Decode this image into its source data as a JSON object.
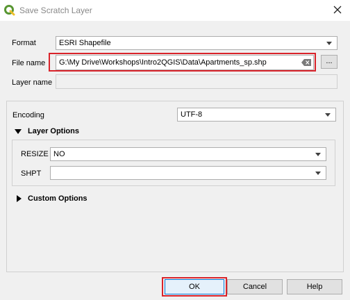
{
  "window": {
    "title": "Save Scratch Layer"
  },
  "form": {
    "format_label": "Format",
    "format_value": "ESRI Shapefile",
    "filename_label": "File name",
    "filename_value": "G:\\My Drive\\Workshops\\Intro2QGIS\\Data\\Apartments_sp.shp",
    "browse_label": "...",
    "layername_label": "Layer name",
    "layername_value": ""
  },
  "encoding": {
    "label": "Encoding",
    "value": "UTF-8"
  },
  "layer_options": {
    "title": "Layer Options",
    "expanded": true,
    "resize_label": "RESIZE",
    "resize_value": "NO",
    "shpt_label": "SHPT",
    "shpt_value": ""
  },
  "custom_options": {
    "title": "Custom Options",
    "expanded": false
  },
  "buttons": {
    "ok": "OK",
    "cancel": "Cancel",
    "help": "Help"
  },
  "colors": {
    "highlight": "#d9232a",
    "qgis_green": "#589632",
    "qgis_yellow": "#eebe2a"
  }
}
